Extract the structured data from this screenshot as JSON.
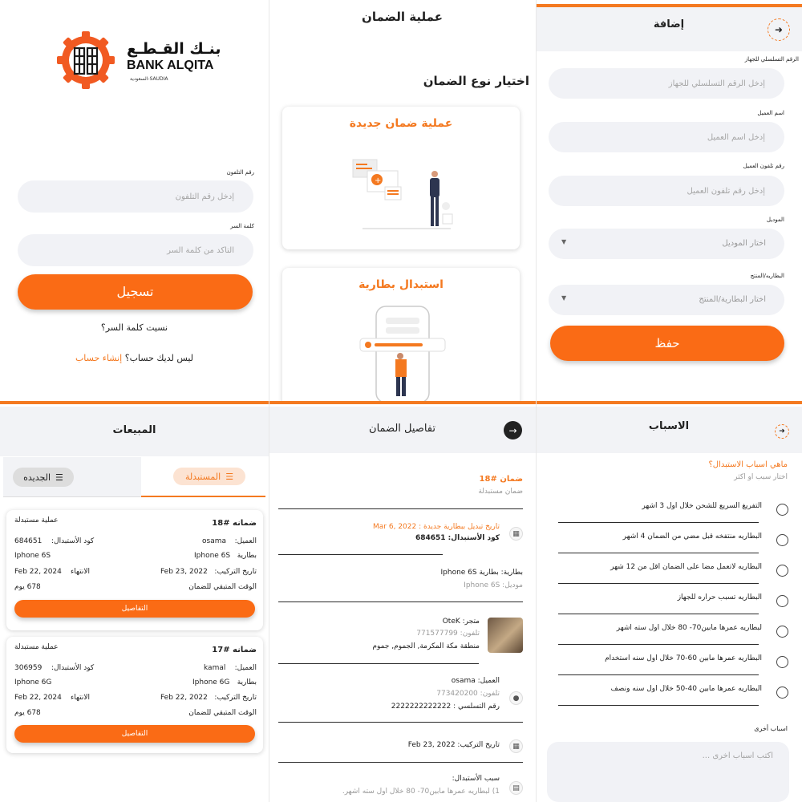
{
  "colors": {
    "accent": "#fa6b15",
    "accent_text": "#f47920",
    "header_bg": "#f2f3f6",
    "field_bg": "#f1f2f6"
  },
  "login": {
    "logo_ar": "بنـك القـطـع",
    "logo_en": "BANK ALQITA",
    "logo_sub": "السعودية-SAUDIA",
    "phone_label": "رقم التلفون",
    "phone_placeholder": "إدخل رقم التلفون",
    "password_label": "كلمة السر",
    "password_placeholder": "التأكد من كلمة السر",
    "login_button": "تسجيل",
    "forgot": "نسيت كلمة السر؟",
    "no_account": "ليس لديك حساب؟",
    "create_account": "إنشاء حساب"
  },
  "warranty_type": {
    "title": "عملية الضمان",
    "subtitle": "اختيار نوع الضمان",
    "card_new": "عملية ضمان جديدة",
    "card_replace": "استبدال بطارية"
  },
  "add_form": {
    "title": "إضافة",
    "back_icon": "arrow-right-circle-icon",
    "serial_label": "الرقم التسلسلي للجهاز",
    "serial_placeholder": "إدخل الرقم التسلسلي للجهاز",
    "customer_label": "اسم العميل",
    "customer_placeholder": "إدخل اسم العميل",
    "phone_label": "رقم تلفون العميل",
    "phone_placeholder": "إدخل رقم تلفون العميل",
    "model_label": "الموديل",
    "model_placeholder": "اختار الموديل",
    "battery_label": "البطاريه/المنتج",
    "battery_placeholder": "اختار البطارية/المنتج",
    "save_button": "حفظ"
  },
  "sales": {
    "title": "المبيعات",
    "tab_replaced": "المستبدلة",
    "tab_new": "الجديده",
    "cards": [
      {
        "title": "ضمانه #18",
        "status": "عملية مستبدلة",
        "customer_label": "العميل:",
        "customer": "osama",
        "code_label": "كود الأستبدال:",
        "code": "684651",
        "battery_label": "بطارية",
        "battery": "Iphone 6S",
        "model": "Iphone 6S",
        "install_label": "تاريخ التركيب:",
        "install": "Feb 23, 2022",
        "expiry_label": "الانتهاء",
        "expiry": "Feb 22, 2024",
        "remain_label": "الوقت المتبقي للضمان",
        "remain": "678 يوم",
        "button": "التفاصيل"
      },
      {
        "title": "ضمانه #17",
        "status": "عملية مستبدلة",
        "customer_label": "العميل:",
        "customer": "kamal",
        "code_label": "كود الأستبدال:",
        "code": "306959",
        "battery_label": "بطارية",
        "battery": "Iphone 6G",
        "model": "Iphone 6G",
        "install_label": "تاريخ التركيب:",
        "install": "Feb 22, 2022",
        "expiry_label": "الانتهاء",
        "expiry": "Feb 22, 2024",
        "remain_label": "الوقت المتبقي للضمان",
        "remain": "678 يوم",
        "button": "التفاصيل"
      }
    ]
  },
  "details": {
    "title": "تفاصيل الضمان",
    "warranty_no": "ضمان #18",
    "warranty_status": "ضمان مستبدلة",
    "replace_date": "تاريخ تبديل ببطارية جديدة : Mar 6, 2022",
    "replace_code": "كود الأستبدال: 684651",
    "battery_line": "بطارية: بطارية Iphone 6S",
    "model_line": "موديل: Iphone 6S",
    "store_line": "متجر: OteK",
    "store_phone": "تلفون: 771577799",
    "store_address": "منطقة مكة المكرمة, الجموم, جموم",
    "customer_line": "العميل: osama",
    "customer_phone": "تلفون: 773420200",
    "serial_line": "رقم التسلسي : 2222222222222",
    "install_line": "تاريخ التركيب: Feb 23, 2022",
    "reason_title": "سبب الأستبدال:",
    "reason_text": "1) لبطاريه عمرها مابين70- 80 خلال اول سته اشهر."
  },
  "reasons": {
    "title": "الاسباب",
    "question": "ماهي اسباب الاستبدال؟",
    "hint": "اختار سبب او اكثر",
    "items": [
      "التفريغ السريع للشحن خلال اول 3 اشهر",
      "البطاريه منتفخه قبل مضي من الضمان 4 اشهر",
      "البطاريه لاتعمل مضا على الضمان اقل من 12 شهر",
      "البطاريه تسبب حراره للجهاز",
      "لبطاريه عمرها مابين70- 80 خلال اول سته اشهر",
      "البطاريه عمرها مابين 60-70 خلال اول سنه استخدام",
      "البطاريه عمرها مابين 40-50 خلال اول سنه ونصف"
    ],
    "other_label": "اسباب أخرى",
    "other_placeholder": "اكتب اسباب اخرى ..."
  }
}
